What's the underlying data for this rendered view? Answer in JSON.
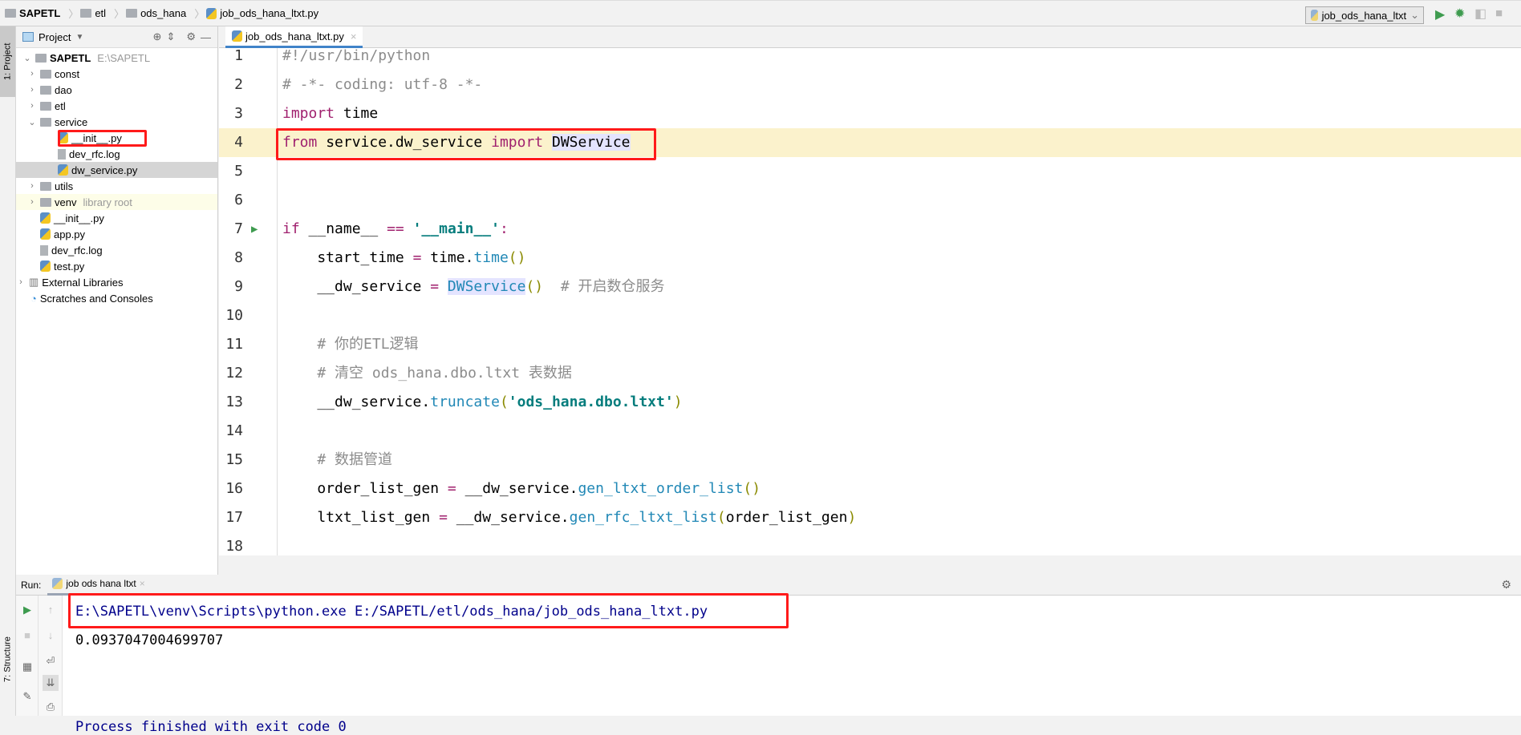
{
  "breadcrumb": [
    "SAPETL",
    "etl",
    "ods_hana",
    "job_ods_hana_ltxt.py"
  ],
  "run_config": {
    "label": "job_ods_hana_ltxt"
  },
  "left_stripe": {
    "project_tab": "1: Project",
    "structure_tab": "7: Structure"
  },
  "project": {
    "title": "Project",
    "tree": [
      {
        "label": "SAPETL",
        "hint": "E:\\SAPETL",
        "kind": "root"
      },
      {
        "label": "const",
        "kind": "folder"
      },
      {
        "label": "dao",
        "kind": "folder"
      },
      {
        "label": "etl",
        "kind": "folder"
      },
      {
        "label": "service",
        "kind": "folder-open"
      },
      {
        "label": "__init__.py",
        "kind": "py",
        "depth": 2
      },
      {
        "label": "dev_rfc.log",
        "kind": "log",
        "depth": 2
      },
      {
        "label": "dw_service.py",
        "kind": "py",
        "depth": 2,
        "selected": true
      },
      {
        "label": "utils",
        "kind": "folder"
      },
      {
        "label": "venv",
        "hint": "library root",
        "kind": "folder"
      },
      {
        "label": "__init__.py",
        "kind": "py"
      },
      {
        "label": "app.py",
        "kind": "py"
      },
      {
        "label": "dev_rfc.log",
        "kind": "log"
      },
      {
        "label": "test.py",
        "kind": "py"
      },
      {
        "label": "External Libraries",
        "kind": "lib"
      },
      {
        "label": "Scratches and Consoles",
        "kind": "scratch"
      }
    ]
  },
  "editor": {
    "tab": "job_ods_hana_ltxt.py",
    "lines": [
      [
        [
          "#!/usr/bin/python",
          "cm"
        ]
      ],
      [
        [
          "# -*- coding: utf-8 -*-",
          "cm"
        ]
      ],
      [
        [
          "import",
          "kw"
        ],
        [
          " time",
          ""
        ]
      ],
      [
        [
          "from",
          "kw"
        ],
        [
          " service.dw_service ",
          ""
        ],
        [
          "import",
          "kw"
        ],
        [
          " ",
          ""
        ],
        [
          "DWService",
          "hl"
        ]
      ],
      [],
      [],
      [
        [
          "if",
          "kw"
        ],
        [
          " __name__ ",
          ""
        ],
        [
          "==",
          "op"
        ],
        [
          " ",
          ""
        ],
        [
          "'__main__'",
          "str"
        ],
        [
          ":",
          "op"
        ]
      ],
      [
        [
          "    start_time ",
          ""
        ],
        [
          "=",
          "op"
        ],
        [
          " time.",
          ""
        ],
        [
          "time",
          "fn"
        ],
        [
          "()",
          "par"
        ]
      ],
      [
        [
          "    __dw_service ",
          ""
        ],
        [
          "=",
          "op"
        ],
        [
          " ",
          ""
        ],
        [
          "DWService",
          "fn hl"
        ],
        [
          "()",
          "par"
        ],
        [
          "  # 开启数仓服务",
          "cm"
        ]
      ],
      [],
      [
        [
          "    # 你的ETL逻辑",
          "cm"
        ]
      ],
      [
        [
          "    # 清空 ods_hana.dbo.ltxt 表数据",
          "cm"
        ]
      ],
      [
        [
          "    __dw_service.",
          ""
        ],
        [
          "truncate",
          "fn"
        ],
        [
          "(",
          "par"
        ],
        [
          "'ods_hana.dbo.ltxt'",
          "str"
        ],
        [
          ")",
          "par"
        ]
      ],
      [],
      [
        [
          "    # 数据管道",
          "cm"
        ]
      ],
      [
        [
          "    order_list_gen ",
          ""
        ],
        [
          "=",
          "op"
        ],
        [
          " __dw_service.",
          ""
        ],
        [
          "gen_ltxt_order_list",
          "fn"
        ],
        [
          "()",
          "par"
        ]
      ],
      [
        [
          "    ltxt_list_gen ",
          ""
        ],
        [
          "=",
          "op"
        ],
        [
          " __dw_service.",
          ""
        ],
        [
          "gen_rfc_ltxt_list",
          "fn"
        ],
        [
          "(",
          "par"
        ],
        [
          "order_list_gen",
          ""
        ],
        [
          ")",
          "par"
        ]
      ],
      []
    ]
  },
  "run": {
    "label": "Run:",
    "tab": "job ods hana ltxt",
    "output": [
      "E:\\SAPETL\\venv\\Scripts\\python.exe E:/SAPETL/etl/ods_hana/job_ods_hana_ltxt.py",
      "0.0937047004699707",
      "",
      "",
      "Process finished with exit code 0"
    ]
  },
  "colors": {
    "annotation": "#ff1a1a",
    "current_line": "#fbf2cc",
    "selected_row": "#d5d5d5"
  }
}
